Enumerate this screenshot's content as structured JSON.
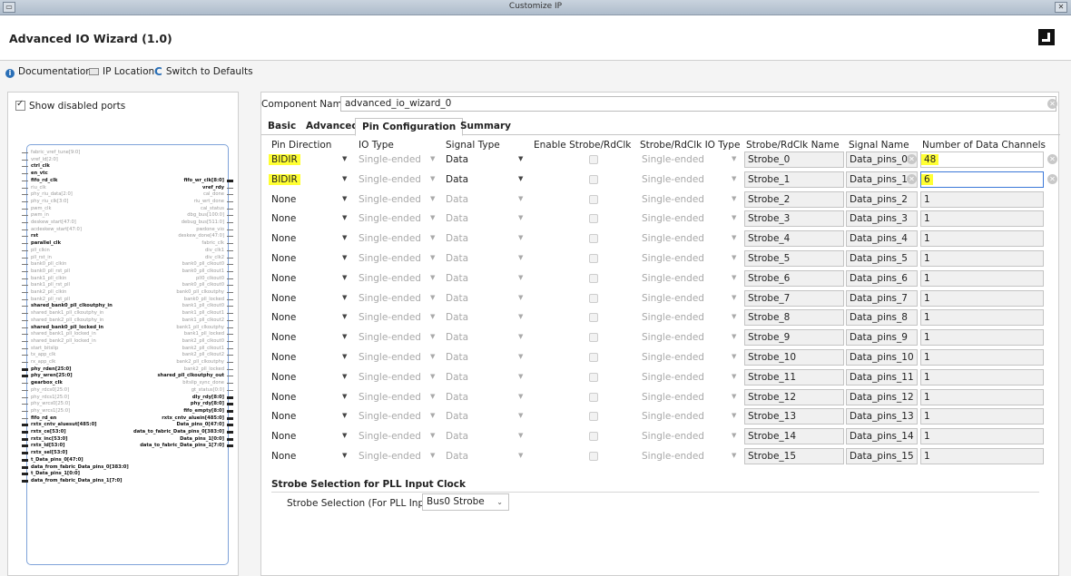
{
  "window": {
    "title": "Customize IP",
    "menu_glyph": "▭",
    "close_glyph": "✕"
  },
  "header": {
    "title": "Advanced IO Wizard (1.0)",
    "logo": "amd-logo"
  },
  "toolbar": {
    "documentation": "Documentation",
    "ip_location": "IP Location",
    "switch_defaults": "Switch to Defaults",
    "info_glyph": "i",
    "reset_glyph": "C"
  },
  "left": {
    "show_disabled_ports": "Show disabled ports",
    "block_pins_left": [
      {
        "label": "fabric_vref_tune[9:0]",
        "bold": false,
        "bus": false
      },
      {
        "label": "vref_ld[2:0]",
        "bold": false,
        "bus": false
      },
      {
        "label": "ctrl_clk",
        "bold": true,
        "bus": false
      },
      {
        "label": "en_vtc",
        "bold": true,
        "bus": false
      },
      {
        "label": "fifo_rd_clk",
        "bold": true,
        "bus": false
      },
      {
        "label": "riu_clk",
        "bold": false,
        "bus": false
      },
      {
        "label": "phy_riu_data[2:0]",
        "bold": false,
        "bus": false
      },
      {
        "label": "phy_riu_clk[3:0]",
        "bold": false,
        "bus": false
      },
      {
        "label": "pwm_clk",
        "bold": false,
        "bus": false
      },
      {
        "label": "pwm_in",
        "bold": false,
        "bus": false
      },
      {
        "label": "deskew_start[47:0]",
        "bold": false,
        "bus": false
      },
      {
        "label": "acdeskew_start[47:0]",
        "bold": false,
        "bus": false
      },
      {
        "label": "rst",
        "bold": true,
        "bus": false
      },
      {
        "label": "parallel_clk",
        "bold": true,
        "bus": false
      },
      {
        "label": "pll_clkin",
        "bold": false,
        "bus": false
      },
      {
        "label": "pll_rst_in",
        "bold": false,
        "bus": false
      },
      {
        "label": "bank0_pll_clkin",
        "bold": false,
        "bus": false
      },
      {
        "label": "bank0_pll_rst_pll",
        "bold": false,
        "bus": false
      },
      {
        "label": "bank1_pll_clkin",
        "bold": false,
        "bus": false
      },
      {
        "label": "bank1_pll_rst_pll",
        "bold": false,
        "bus": false
      },
      {
        "label": "bank2_pll_clkin",
        "bold": false,
        "bus": false
      },
      {
        "label": "bank2_pll_rst_pll",
        "bold": false,
        "bus": false
      },
      {
        "label": "shared_bank0_pll_clkoutphy_in",
        "bold": true,
        "bus": false
      },
      {
        "label": "shared_bank1_pll_clkoutphy_in",
        "bold": false,
        "bus": false
      },
      {
        "label": "shared_bank2_pll_clkoutphy_in",
        "bold": false,
        "bus": false
      },
      {
        "label": "shared_bank0_pll_locked_in",
        "bold": true,
        "bus": false
      },
      {
        "label": "shared_bank1_pll_locked_in",
        "bold": false,
        "bus": false
      },
      {
        "label": "shared_bank2_pll_locked_in",
        "bold": false,
        "bus": false
      },
      {
        "label": "start_bitslip",
        "bold": false,
        "bus": false
      },
      {
        "label": "tx_app_clk",
        "bold": false,
        "bus": false
      },
      {
        "label": "rx_app_clk",
        "bold": false,
        "bus": false
      },
      {
        "label": "phy_rden[25:0]",
        "bold": true,
        "bus": true
      },
      {
        "label": "phy_wren[25:0]",
        "bold": true,
        "bus": true
      },
      {
        "label": "gearbox_clk",
        "bold": true,
        "bus": false
      },
      {
        "label": "phy_rdcs0[25:0]",
        "bold": false,
        "bus": false
      },
      {
        "label": "phy_rdcs1[25:0]",
        "bold": false,
        "bus": false
      },
      {
        "label": "phy_wrcs0[25:0]",
        "bold": false,
        "bus": false
      },
      {
        "label": "phy_wrcs1[25:0]",
        "bold": false,
        "bus": false
      },
      {
        "label": "fifo_rd_en",
        "bold": true,
        "bus": false
      },
      {
        "label": "rxtx_cntv_aluesut[485:0]",
        "bold": true,
        "bus": true
      },
      {
        "label": "rxtx_ce[53:0]",
        "bold": true,
        "bus": true
      },
      {
        "label": "rxtx_inc[53:0]",
        "bold": true,
        "bus": true
      },
      {
        "label": "rxtx_ld[53:0]",
        "bold": true,
        "bus": true
      },
      {
        "label": "rxtx_sel[53:0]",
        "bold": true,
        "bus": true
      },
      {
        "label": "t_Data_pins_0[47:0]",
        "bold": true,
        "bus": true
      },
      {
        "label": "data_from_fabric_Data_pins_0[383:0]",
        "bold": true,
        "bus": true
      },
      {
        "label": "t_Data_pins_1[0:0]",
        "bold": true,
        "bus": true
      },
      {
        "label": "data_from_fabric_Data_pins_1[7:0]",
        "bold": true,
        "bus": true
      }
    ],
    "block_pins_right": [
      {
        "label": "fifo_wr_clk[8:0]",
        "bold": true,
        "bus": true
      },
      {
        "label": "vref_rdy",
        "bold": true,
        "bus": false
      },
      {
        "label": "cal_done",
        "bold": false,
        "bus": false
      },
      {
        "label": "riu_wrt_done",
        "bold": false,
        "bus": false
      },
      {
        "label": "cal_status",
        "bold": false,
        "bus": false
      },
      {
        "label": "dbg_bus[100:0]",
        "bold": false,
        "bus": false
      },
      {
        "label": "debug_bus[511:0]",
        "bold": false,
        "bus": false
      },
      {
        "label": "pwdone_vio",
        "bold": false,
        "bus": false
      },
      {
        "label": "deskew_done[47:0]",
        "bold": false,
        "bus": false
      },
      {
        "label": "fabric_clk",
        "bold": false,
        "bus": false
      },
      {
        "label": "div_clk1",
        "bold": false,
        "bus": false
      },
      {
        "label": "div_clk2",
        "bold": false,
        "bus": false
      },
      {
        "label": "bank0_pll_clkout0",
        "bold": false,
        "bus": false
      },
      {
        "label": "bank0_pll_clkout1",
        "bold": false,
        "bus": false
      },
      {
        "label": "pll0_clkout0",
        "bold": false,
        "bus": false
      },
      {
        "label": "bank0_pll_clkout0",
        "bold": false,
        "bus": false
      },
      {
        "label": "bank0_pll_clkoutphy",
        "bold": false,
        "bus": false
      },
      {
        "label": "bank0_pll_locked",
        "bold": false,
        "bus": false
      },
      {
        "label": "bank1_pll_clkout0",
        "bold": false,
        "bus": false
      },
      {
        "label": "bank1_pll_clkout1",
        "bold": false,
        "bus": false
      },
      {
        "label": "bank1_pll_clkout2",
        "bold": false,
        "bus": false
      },
      {
        "label": "bank1_pll_clkoutphy",
        "bold": false,
        "bus": false
      },
      {
        "label": "bank1_pll_locked",
        "bold": false,
        "bus": false
      },
      {
        "label": "bank2_pll_clkout0",
        "bold": false,
        "bus": false
      },
      {
        "label": "bank2_pll_clkout1",
        "bold": false,
        "bus": false
      },
      {
        "label": "bank2_pll_clkout2",
        "bold": false,
        "bus": false
      },
      {
        "label": "bank2_pll_clkoutphy",
        "bold": false,
        "bus": false
      },
      {
        "label": "bank2_pll_locked",
        "bold": false,
        "bus": false
      },
      {
        "label": "shared_pll_clkoutphy_out",
        "bold": true,
        "bus": false
      },
      {
        "label": "bitslip_sync_done",
        "bold": false,
        "bus": false
      },
      {
        "label": "gt_status[0:0]",
        "bold": false,
        "bus": false
      },
      {
        "label": "dly_rdy[8:0]",
        "bold": true,
        "bus": true
      },
      {
        "label": "phy_rdy[8:0]",
        "bold": true,
        "bus": true
      },
      {
        "label": "fifo_empty[8:0]",
        "bold": true,
        "bus": true
      },
      {
        "label": "rxtx_cntv_aluein[485:0]",
        "bold": true,
        "bus": true
      },
      {
        "label": "Data_pins_0[47:0]",
        "bold": true,
        "bus": true
      },
      {
        "label": "data_to_fabric_Data_pins_0[383:0]",
        "bold": true,
        "bus": true
      },
      {
        "label": "Data_pins_1[0:0]",
        "bold": true,
        "bus": true
      },
      {
        "label": "data_to_fabric_Data_pins_1[7:0]",
        "bold": true,
        "bus": true
      }
    ]
  },
  "right": {
    "component_name_label": "Component Name",
    "component_name_value": "advanced_io_wizard_0",
    "tabs": [
      "Basic",
      "Advanced",
      "Pin Configuration",
      "Summary"
    ],
    "active_tab": "Pin Configuration",
    "columns": [
      "Pin Direction",
      "IO Type",
      "Signal Type",
      "Enable Strobe/RdClk",
      "Strobe/RdClk IO Type",
      "Strobe/RdClk Name",
      "Signal Name",
      "Number of Data Channels"
    ],
    "rows": [
      {
        "dir": "BIDIR",
        "io": "Single-ended",
        "sig": "Data",
        "strobe_io": "Single-ended",
        "strobe_name": "Strobe_0",
        "signal_name": "Data_pins_0",
        "channels": "48",
        "active": true
      },
      {
        "dir": "BIDIR",
        "io": "Single-ended",
        "sig": "Data",
        "strobe_io": "Single-ended",
        "strobe_name": "Strobe_1",
        "signal_name": "Data_pins_1",
        "channels": "6",
        "active": true
      },
      {
        "dir": "None",
        "io": "Single-ended",
        "sig": "Data",
        "strobe_io": "Single-ended",
        "strobe_name": "Strobe_2",
        "signal_name": "Data_pins_2",
        "channels": "1",
        "active": false
      },
      {
        "dir": "None",
        "io": "Single-ended",
        "sig": "Data",
        "strobe_io": "Single-ended",
        "strobe_name": "Strobe_3",
        "signal_name": "Data_pins_3",
        "channels": "1",
        "active": false
      },
      {
        "dir": "None",
        "io": "Single-ended",
        "sig": "Data",
        "strobe_io": "Single-ended",
        "strobe_name": "Strobe_4",
        "signal_name": "Data_pins_4",
        "channels": "1",
        "active": false
      },
      {
        "dir": "None",
        "io": "Single-ended",
        "sig": "Data",
        "strobe_io": "Single-ended",
        "strobe_name": "Strobe_5",
        "signal_name": "Data_pins_5",
        "channels": "1",
        "active": false
      },
      {
        "dir": "None",
        "io": "Single-ended",
        "sig": "Data",
        "strobe_io": "Single-ended",
        "strobe_name": "Strobe_6",
        "signal_name": "Data_pins_6",
        "channels": "1",
        "active": false
      },
      {
        "dir": "None",
        "io": "Single-ended",
        "sig": "Data",
        "strobe_io": "Single-ended",
        "strobe_name": "Strobe_7",
        "signal_name": "Data_pins_7",
        "channels": "1",
        "active": false
      },
      {
        "dir": "None",
        "io": "Single-ended",
        "sig": "Data",
        "strobe_io": "Single-ended",
        "strobe_name": "Strobe_8",
        "signal_name": "Data_pins_8",
        "channels": "1",
        "active": false
      },
      {
        "dir": "None",
        "io": "Single-ended",
        "sig": "Data",
        "strobe_io": "Single-ended",
        "strobe_name": "Strobe_9",
        "signal_name": "Data_pins_9",
        "channels": "1",
        "active": false
      },
      {
        "dir": "None",
        "io": "Single-ended",
        "sig": "Data",
        "strobe_io": "Single-ended",
        "strobe_name": "Strobe_10",
        "signal_name": "Data_pins_10",
        "channels": "1",
        "active": false
      },
      {
        "dir": "None",
        "io": "Single-ended",
        "sig": "Data",
        "strobe_io": "Single-ended",
        "strobe_name": "Strobe_11",
        "signal_name": "Data_pins_11",
        "channels": "1",
        "active": false
      },
      {
        "dir": "None",
        "io": "Single-ended",
        "sig": "Data",
        "strobe_io": "Single-ended",
        "strobe_name": "Strobe_12",
        "signal_name": "Data_pins_12",
        "channels": "1",
        "active": false
      },
      {
        "dir": "None",
        "io": "Single-ended",
        "sig": "Data",
        "strobe_io": "Single-ended",
        "strobe_name": "Strobe_13",
        "signal_name": "Data_pins_13",
        "channels": "1",
        "active": false
      },
      {
        "dir": "None",
        "io": "Single-ended",
        "sig": "Data",
        "strobe_io": "Single-ended",
        "strobe_name": "Strobe_14",
        "signal_name": "Data_pins_14",
        "channels": "1",
        "active": false
      },
      {
        "dir": "None",
        "io": "Single-ended",
        "sig": "Data",
        "strobe_io": "Single-ended",
        "strobe_name": "Strobe_15",
        "signal_name": "Data_pins_15",
        "channels": "1",
        "active": false
      }
    ],
    "strobe_section_title": "Strobe Selection for PLL Input Clock",
    "strobe_selection_label": "Strobe Selection (For PLL Input)",
    "strobe_selection_value": "Bus0 Strobe",
    "highlight_color": "#ffff33",
    "focus_color": "#3b78d8"
  }
}
